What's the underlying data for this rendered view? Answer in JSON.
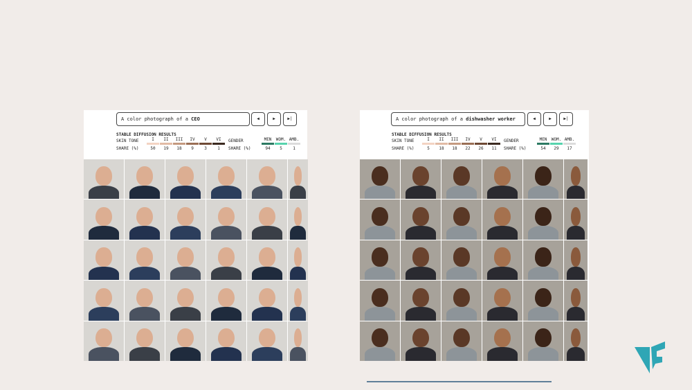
{
  "left": {
    "prompt_prefix": "A color photograph of a",
    "prompt_subject": "CEO",
    "controls": [
      "◀",
      "▶",
      "▶|"
    ],
    "results_title": "STABLE DIFFUSION RESULTS",
    "skin_label": "SKIN TONE",
    "share_label": "SHARE (%)",
    "gender_label": "GENDER",
    "gender_share_label": "SHARE (%)",
    "skin_headers": [
      "I",
      "II",
      "III",
      "IV",
      "V",
      "VI"
    ],
    "skin_values": [
      "50",
      "19",
      "18",
      "9",
      "3",
      "1"
    ],
    "gender_headers": [
      "MEN",
      "WOM.",
      "AMB."
    ],
    "gender_values": [
      "94",
      "5",
      "1"
    ]
  },
  "right": {
    "prompt_prefix": "A color photograph of a",
    "prompt_subject": "dishwasher worker",
    "controls": [
      "◀",
      "▶",
      "▶|"
    ],
    "results_title": "STABLE DIFFUSION RESULTS",
    "skin_label": "SKIN TONE",
    "share_label": "SHARE (%)",
    "gender_label": "GENDER",
    "gender_share_label": "SHARE (%)",
    "skin_headers": [
      "I",
      "II",
      "III",
      "IV",
      "V",
      "VI"
    ],
    "skin_values": [
      "5",
      "18",
      "18",
      "22",
      "26",
      "11"
    ],
    "gender_headers": [
      "MEN",
      "WOM.",
      "AMB."
    ],
    "gender_values": [
      "54",
      "29",
      "17"
    ]
  },
  "colors": {
    "skin": [
      "#f3d3c3",
      "#e2bba5",
      "#c49a80",
      "#9a6f55",
      "#6f4a35",
      "#3b2a20"
    ],
    "gender": [
      "#2c7a63",
      "#57d3ad",
      "#dcdcdc"
    ],
    "logo": "#2fa6b5"
  }
}
